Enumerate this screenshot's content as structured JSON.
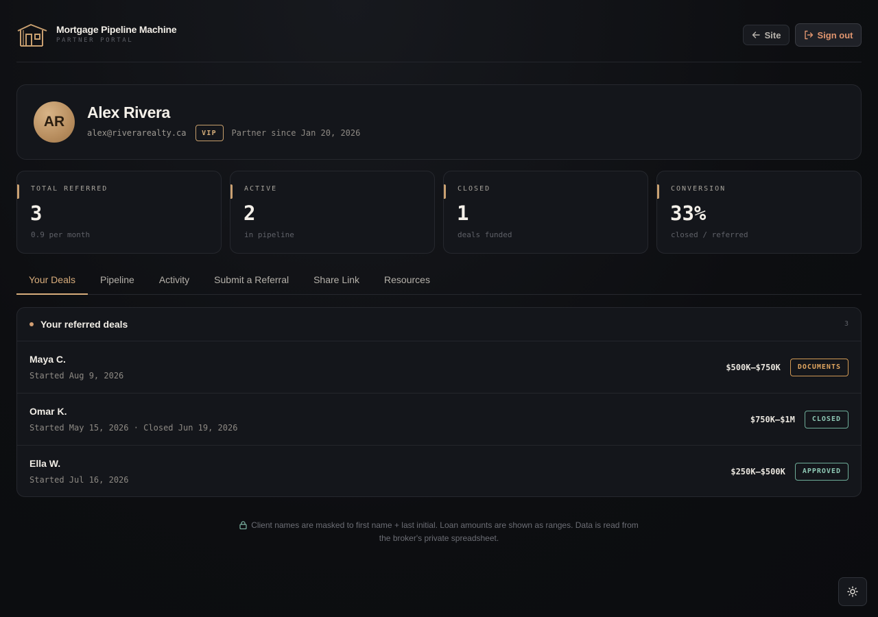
{
  "brand": {
    "title": "Mortgage Pipeline Machine",
    "subtitle": "PARTNER PORTAL"
  },
  "header": {
    "site_label": "Site",
    "signout_label": "Sign out"
  },
  "profile": {
    "initials": "AR",
    "name": "Alex Rivera",
    "email": "alex@riverarealty.ca",
    "tier": "VIP",
    "since": "Partner since Jan 20, 2026"
  },
  "stats": [
    {
      "label": "TOTAL REFERRED",
      "value": "3",
      "sub": "0.9 per month"
    },
    {
      "label": "ACTIVE",
      "value": "2",
      "sub": "in pipeline"
    },
    {
      "label": "CLOSED",
      "value": "1",
      "sub": "deals funded"
    },
    {
      "label": "CONVERSION",
      "value": "33%",
      "sub": "closed / referred"
    }
  ],
  "tabs": [
    {
      "label": "Your Deals",
      "active": true
    },
    {
      "label": "Pipeline"
    },
    {
      "label": "Activity"
    },
    {
      "label": "Submit a Referral"
    },
    {
      "label": "Share Link"
    },
    {
      "label": "Resources"
    }
  ],
  "deals": {
    "title": "Your referred deals",
    "count": "3",
    "rows": [
      {
        "name": "Maya C.",
        "date": "Started Aug 9, 2026",
        "amount": "$500K–$750K",
        "status": "DOCUMENTS",
        "status_color": "#e0a55f"
      },
      {
        "name": "Omar K.",
        "date": "Started May 15, 2026 · Closed Jun 19, 2026",
        "amount": "$750K–$1M",
        "status": "CLOSED",
        "status_color": "#8ec9b5"
      },
      {
        "name": "Ella W.",
        "date": "Started Jul 16, 2026",
        "amount": "$250K–$500K",
        "status": "APPROVED",
        "status_color": "#8ec9b5"
      }
    ]
  },
  "note": {
    "line1": "Client names are masked to first name + last initial. Loan amounts are shown as ranges. Data is read from",
    "line2": "the broker's private spreadsheet."
  },
  "colors": {
    "accent": "#d8ad7c",
    "background": "#0d0e11",
    "card": "#14161b",
    "signout": "#e0956f"
  },
  "icons": {
    "logo": "house-icon",
    "site": "arrow-left-icon",
    "signout": "sign-out-icon",
    "note": "lock-icon",
    "theme": "sun-icon"
  }
}
